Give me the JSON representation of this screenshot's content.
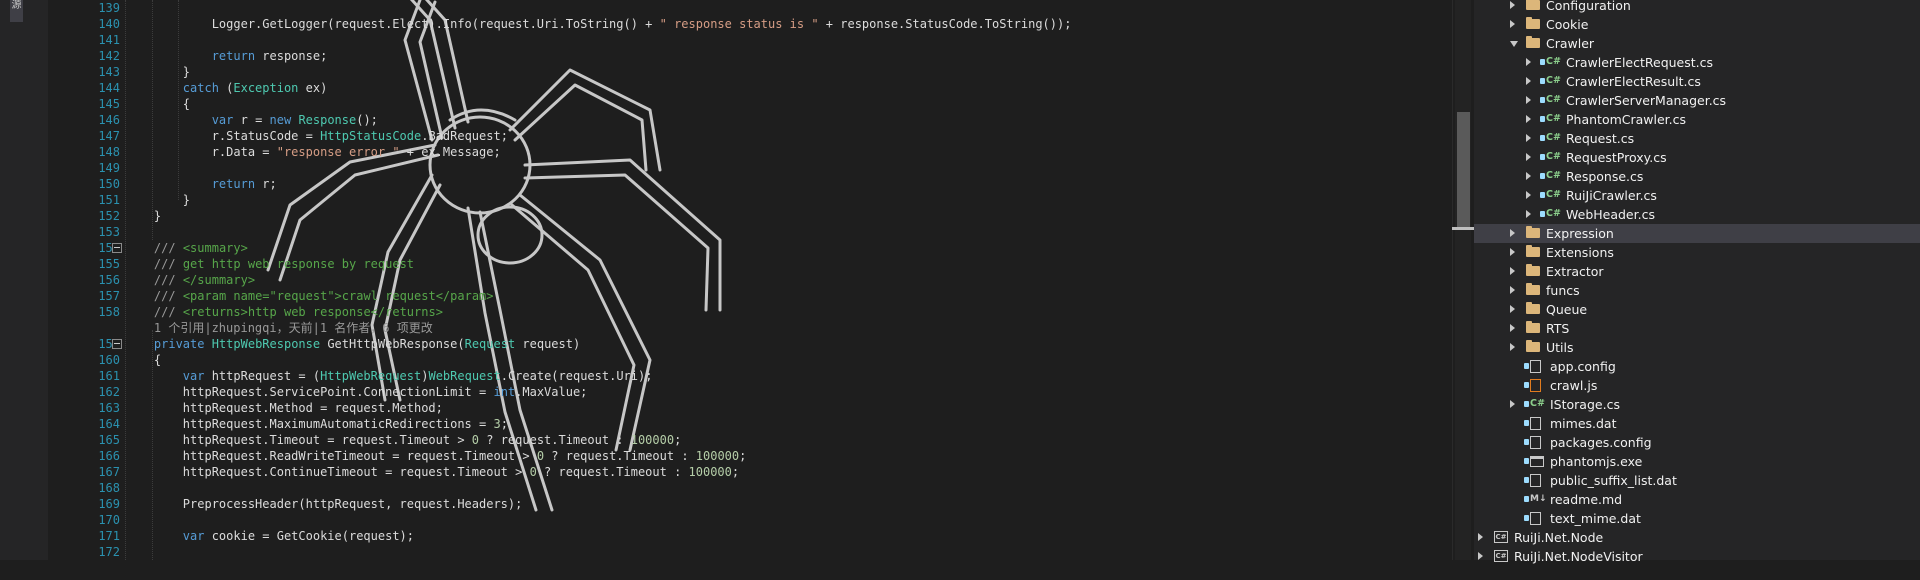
{
  "left_strip": {
    "tab_label": "源"
  },
  "editor": {
    "lines": [
      {
        "n": "139",
        "fold": false,
        "html": ""
      },
      {
        "n": "140",
        "fold": false,
        "html": "            Logger.GetLogger(request.Elect).Info(request.Uri.ToString() + <span class='st'>\" response status is \"</span> + response.StatusCode.ToString());"
      },
      {
        "n": "141",
        "fold": false,
        "html": ""
      },
      {
        "n": "142",
        "fold": false,
        "html": "            <span class='kw'>return</span> response;"
      },
      {
        "n": "143",
        "fold": false,
        "html": "        }"
      },
      {
        "n": "144",
        "fold": false,
        "html": "        <span class='kw'>catch</span> (<span class='ty'>Exception</span> ex)"
      },
      {
        "n": "145",
        "fold": false,
        "html": "        {"
      },
      {
        "n": "146",
        "fold": false,
        "html": "            <span class='kw'>var</span> r = <span class='kw'>new</span> <span class='ty'>Response</span>();"
      },
      {
        "n": "147",
        "fold": false,
        "html": "            r.StatusCode = <span class='ty'>HttpStatusCode</span>.BadRequest;"
      },
      {
        "n": "148",
        "fold": false,
        "html": "            r.Data = <span class='st'>\"response error \"</span> + ex.Message;"
      },
      {
        "n": "149",
        "fold": false,
        "html": ""
      },
      {
        "n": "150",
        "fold": false,
        "html": "            <span class='kw'>return</span> r;"
      },
      {
        "n": "151",
        "fold": false,
        "html": "        }"
      },
      {
        "n": "152",
        "fold": false,
        "html": "    }"
      },
      {
        "n": "153",
        "fold": false,
        "html": ""
      },
      {
        "n": "154",
        "fold": true,
        "html": "    <span class='cl'>///</span> <span class='cm'>&lt;summary&gt;</span>"
      },
      {
        "n": "155",
        "fold": false,
        "html": "    <span class='cl'>///</span> <span class='cm'>get http web response by request</span>"
      },
      {
        "n": "156",
        "fold": false,
        "html": "    <span class='cl'>///</span> <span class='cm'>&lt;/summary&gt;</span>"
      },
      {
        "n": "157",
        "fold": false,
        "html": "    <span class='cl'>///</span> <span class='cm'>&lt;param name=\"request\"&gt;crawl request&lt;/param&gt;</span>"
      },
      {
        "n": "158",
        "fold": false,
        "html": "    <span class='cl'>///</span> <span class='cm'>&lt;returns&gt;http web response&lt;/returns&gt;</span>"
      },
      {
        "n": "",
        "fold": false,
        "html": "    <span class='cl'>1 个引用|zhupingqi，天前|1 名作者，6 项更改</span>"
      },
      {
        "n": "159",
        "fold": true,
        "html": "    <span class='kw'>private</span> <span class='ty'>HttpWebResponse</span> GetHttpWebResponse(<span class='ty'>Request</span> request)"
      },
      {
        "n": "160",
        "fold": false,
        "html": "    {"
      },
      {
        "n": "161",
        "fold": false,
        "html": "        <span class='kw'>var</span> httpRequest = (<span class='ty'>HttpWebRequest</span>)<span class='ty'>WebRequest</span>.Create(request.Uri);"
      },
      {
        "n": "162",
        "fold": false,
        "html": "        httpRequest.ServicePoint.ConnectionLimit = <span class='kw'>int</span>.MaxValue;"
      },
      {
        "n": "163",
        "fold": false,
        "html": "        httpRequest.Method = request.Method;"
      },
      {
        "n": "164",
        "fold": false,
        "html": "        httpRequest.MaximumAutomaticRedirections = <span class='nm'>3</span>;"
      },
      {
        "n": "165",
        "fold": false,
        "html": "        httpRequest.Timeout = request.Timeout &gt; <span class='nm'>0</span> ? request.Timeout : <span class='nm'>100000</span>;"
      },
      {
        "n": "166",
        "fold": false,
        "html": "        httpRequest.ReadWriteTimeout = request.Timeout &gt; <span class='nm'>0</span> ? request.Timeout : <span class='nm'>100000</span>;"
      },
      {
        "n": "167",
        "fold": false,
        "html": "        httpRequest.ContinueTimeout = request.Timeout &gt; <span class='nm'>0</span> ? request.Timeout : <span class='nm'>100000</span>;"
      },
      {
        "n": "168",
        "fold": false,
        "html": ""
      },
      {
        "n": "169",
        "fold": false,
        "html": "        PreprocessHeader(httpRequest, request.Headers);"
      },
      {
        "n": "170",
        "fold": false,
        "html": ""
      },
      {
        "n": "171",
        "fold": false,
        "html": "        <span class='kw'>var</span> cookie = GetCookie(request);"
      },
      {
        "n": "172",
        "fold": false,
        "html": ""
      }
    ]
  },
  "explorer": {
    "items": [
      {
        "label": "Configuration",
        "type": "folder",
        "depth": 2,
        "expander": "closed",
        "lock": false,
        "selected": false
      },
      {
        "label": "Cookie",
        "type": "folder",
        "depth": 2,
        "expander": "closed",
        "lock": false,
        "selected": false
      },
      {
        "label": "Crawler",
        "type": "folder",
        "depth": 2,
        "expander": "open",
        "lock": false,
        "selected": false
      },
      {
        "label": "CrawlerElectRequest.cs",
        "type": "cs",
        "depth": 3,
        "expander": "closed",
        "lock": true,
        "selected": false
      },
      {
        "label": "CrawlerElectResult.cs",
        "type": "cs",
        "depth": 3,
        "expander": "closed",
        "lock": true,
        "selected": false
      },
      {
        "label": "CrawlerServerManager.cs",
        "type": "cs",
        "depth": 3,
        "expander": "closed",
        "lock": true,
        "selected": false
      },
      {
        "label": "PhantomCrawler.cs",
        "type": "cs",
        "depth": 3,
        "expander": "closed",
        "lock": true,
        "selected": false
      },
      {
        "label": "Request.cs",
        "type": "cs",
        "depth": 3,
        "expander": "closed",
        "lock": true,
        "selected": false
      },
      {
        "label": "RequestProxy.cs",
        "type": "cs",
        "depth": 3,
        "expander": "closed",
        "lock": true,
        "selected": false
      },
      {
        "label": "Response.cs",
        "type": "cs",
        "depth": 3,
        "expander": "closed",
        "lock": true,
        "selected": false
      },
      {
        "label": "RuiJiCrawler.cs",
        "type": "cs",
        "depth": 3,
        "expander": "closed",
        "lock": true,
        "selected": false
      },
      {
        "label": "WebHeader.cs",
        "type": "cs",
        "depth": 3,
        "expander": "closed",
        "lock": true,
        "selected": false
      },
      {
        "label": "Expression",
        "type": "folder",
        "depth": 2,
        "expander": "closed",
        "lock": false,
        "selected": true
      },
      {
        "label": "Extensions",
        "type": "folder",
        "depth": 2,
        "expander": "closed",
        "lock": false,
        "selected": false
      },
      {
        "label": "Extractor",
        "type": "folder",
        "depth": 2,
        "expander": "closed",
        "lock": false,
        "selected": false
      },
      {
        "label": "funcs",
        "type": "folder",
        "depth": 2,
        "expander": "closed",
        "lock": false,
        "selected": false
      },
      {
        "label": "Queue",
        "type": "folder",
        "depth": 2,
        "expander": "closed",
        "lock": false,
        "selected": false
      },
      {
        "label": "RTS",
        "type": "folder",
        "depth": 2,
        "expander": "closed",
        "lock": false,
        "selected": false
      },
      {
        "label": "Utils",
        "type": "folder",
        "depth": 2,
        "expander": "closed",
        "lock": false,
        "selected": false
      },
      {
        "label": "app.config",
        "type": "config",
        "depth": 2,
        "expander": "none",
        "lock": true,
        "selected": false
      },
      {
        "label": "crawl.js",
        "type": "js",
        "depth": 2,
        "expander": "none",
        "lock": true,
        "selected": false
      },
      {
        "label": "IStorage.cs",
        "type": "cs",
        "depth": 2,
        "expander": "closed",
        "lock": true,
        "selected": false
      },
      {
        "label": "mimes.dat",
        "type": "file",
        "depth": 2,
        "expander": "none",
        "lock": true,
        "selected": false
      },
      {
        "label": "packages.config",
        "type": "config",
        "depth": 2,
        "expander": "none",
        "lock": true,
        "selected": false
      },
      {
        "label": "phantomjs.exe",
        "type": "exe",
        "depth": 2,
        "expander": "none",
        "lock": true,
        "selected": false
      },
      {
        "label": "public_suffix_list.dat",
        "type": "file",
        "depth": 2,
        "expander": "none",
        "lock": true,
        "selected": false
      },
      {
        "label": "readme.md",
        "type": "md",
        "depth": 2,
        "expander": "none",
        "lock": true,
        "selected": false
      },
      {
        "label": "text_mime.dat",
        "type": "file",
        "depth": 2,
        "expander": "none",
        "lock": true,
        "selected": false
      },
      {
        "label": "RuiJi.Net.Node",
        "type": "project",
        "depth": 0,
        "expander": "closed",
        "lock": false,
        "selected": false
      },
      {
        "label": "RuiJi.Net.NodeVisitor",
        "type": "project",
        "depth": 0,
        "expander": "closed",
        "lock": false,
        "selected": false
      }
    ]
  },
  "colors": {
    "editor_bg": "#1e1e1e",
    "line_number": "#2b91af",
    "keyword": "#569cd6",
    "type": "#4ec9b0",
    "string": "#d69d85",
    "comment": "#57a64a",
    "explorer_bg": "#252526",
    "selection": "#3f3f46"
  }
}
